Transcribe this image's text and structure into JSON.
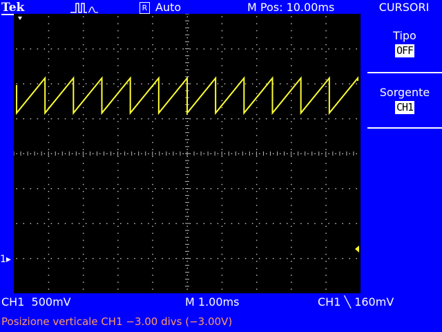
{
  "header": {
    "brand": "Tek",
    "trigger_icon": "trigger-pulse-icon",
    "run_badge": "R",
    "acquisition_mode": "Auto",
    "horizontal_position": "M Pos: 10.00ms"
  },
  "menu": {
    "title": "CURSORI",
    "items": [
      {
        "label": "Tipo",
        "value": "OFF"
      },
      {
        "label": "Sorgente",
        "value": "CH1"
      }
    ]
  },
  "display": {
    "channel_marker": "1",
    "trace_color": "#ffff33",
    "trace": {
      "waveform": "sawtooth",
      "periods_visible": 12,
      "high_div": 1.8,
      "low_div": 2.8,
      "vertical_divisions": 8,
      "horizontal_divisions": 10
    }
  },
  "status": {
    "channel_scale": "CH1  500mV",
    "timebase": "M 1.00ms",
    "trigger": "CH1 ╲ 160mV"
  },
  "message": "Posizione verticale CH1 −3.00 divs (−3.00V)",
  "colors": {
    "background": "#0000ff",
    "graticule_bg": "#000000",
    "trace": "#ffff33",
    "message": "#ff9a66"
  }
}
